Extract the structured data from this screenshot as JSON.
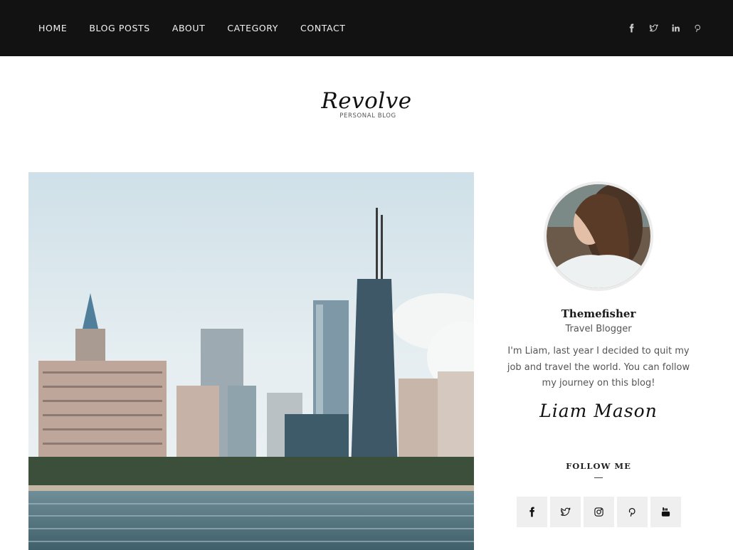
{
  "nav": {
    "items": [
      {
        "label": "HOME"
      },
      {
        "label": "BLOG POSTS"
      },
      {
        "label": "ABOUT"
      },
      {
        "label": "CATEGORY"
      },
      {
        "label": "CONTACT"
      }
    ],
    "social": [
      "facebook-icon",
      "twitter-icon",
      "linkedin-icon",
      "pinterest-icon"
    ]
  },
  "logo": {
    "title": "Revolve",
    "subtitle": "PERSONAL BLOG"
  },
  "hero": {
    "alt": "City skyline across the water"
  },
  "sidebar": {
    "author_name": "Themefisher",
    "author_role": "Travel Blogger",
    "bio": "I'm Liam, last year I decided to quit my job and travel the world. You can follow my journey on this blog!",
    "signature": "Liam Mason",
    "follow_title": "FOLLOW ME",
    "follow_icons": [
      "facebook-icon",
      "twitter-icon",
      "instagram-icon",
      "pinterest-icon",
      "youtube-icon"
    ]
  },
  "colors": {
    "topbar": "#121212",
    "nav_text": "#f2f2f2",
    "icon_tile": "#efefef"
  }
}
